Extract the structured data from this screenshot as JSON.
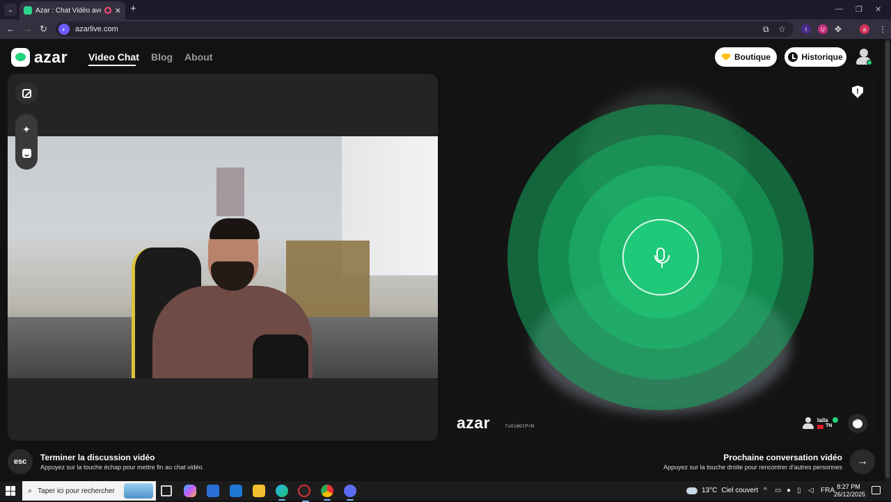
{
  "browser": {
    "tab_title": "Azar : Chat Vidéo avec de n",
    "tab_close": "✕",
    "new_tab": "+",
    "url": "azarlive.com",
    "back": "←",
    "forward": "→",
    "reload": "↻",
    "minimize": "—",
    "restore": "❐",
    "close": "✕",
    "menu": "⋮",
    "extensions": [
      {
        "name": "t",
        "color": "#4a2a8a"
      },
      {
        "name": "U",
        "color": "#c0307a"
      },
      {
        "name": "a",
        "color": "#d0345a"
      }
    ]
  },
  "site": {
    "logo_text": "azar",
    "nav": {
      "video_chat": "Video Chat",
      "blog": "Blog",
      "about": "About"
    },
    "boutique_label": "Boutique",
    "historique_label": "Historique"
  },
  "left_panel": {
    "tools": [
      "expand-icon",
      "sparkle-icon",
      "sticker-icon"
    ],
    "sparkle_glyph": "✦"
  },
  "right_panel": {
    "report_glyph": "!",
    "watermark_logo": "azar",
    "watermark_id": "7uXiWGtPrN",
    "peer_name": "laila",
    "peer_country": "TN",
    "accent_color": "#1ec97a"
  },
  "bottom_bar": {
    "esc_label": "esc",
    "end_title": "Terminer la discussion vidéo",
    "end_subtitle": "Appuyez sur la touche échap pour mettre fin au chat vidéo.",
    "next_title": "Prochaine conversation vidéo",
    "next_subtitle": "Appuyez sur la touche droite pour rencontrer d'autres personnes",
    "next_arrow": "→"
  },
  "taskbar": {
    "search_placeholder": "Taper ici pour rechercher",
    "weather_temp": "13°C",
    "weather_text": "Ciel couvert",
    "language": "FRA",
    "time": "8:27 PM",
    "date": "26/12/2025"
  }
}
